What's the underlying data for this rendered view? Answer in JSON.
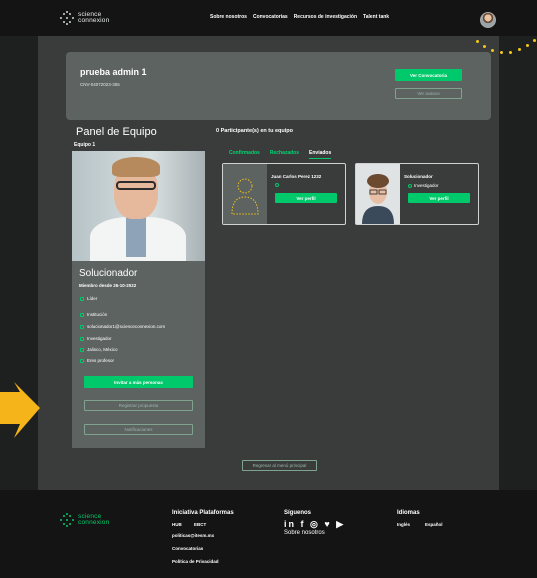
{
  "brand": {
    "line1": "science",
    "line2": "connexion"
  },
  "nav": [
    "Sobre nosotros",
    "Convocatorias",
    "Recursos de investigación",
    "Talent tank"
  ],
  "header": {
    "title": "prueba admin 1",
    "code": "CNV-04072023-355",
    "btn_primary": "Ver Convocatoria",
    "btn_secondary": "Ver avance"
  },
  "panel": {
    "title": "Panel de Equipo",
    "team": "Equipo 1"
  },
  "profile": {
    "role": "Solucionador",
    "since": "Miembro desde 26-10-2022",
    "lines": [
      "Líder",
      "Institución",
      "solucionador1@scienceconnexion.com",
      "Investigador",
      "Jalisco, México",
      "Eres profesor"
    ],
    "btn_invite": "Invitar a más personas",
    "btn_register": "Registrar propuesta",
    "btn_notifications": "Notificaciones"
  },
  "participants": {
    "title": "0 Participante(s) en tu equipo",
    "tabs": [
      "Confirmados",
      "Rechazados",
      "Enviados"
    ],
    "active_tab": "Enviados",
    "cards": [
      {
        "name": "Juan Carlos Perez 1232",
        "role": "",
        "button": "Ver perfil"
      },
      {
        "name": "Solucionador",
        "role": "Investigador",
        "button": "Ver perfil"
      }
    ]
  },
  "return_button": "Regresar al menú principal",
  "footer": {
    "col1": {
      "title": "Iniciativa Plataformas",
      "items": [
        "HUB",
        "EBCT",
        "politicas@itesm.mx",
        "Convocatorias",
        "Política de Privacidad"
      ]
    },
    "col2": {
      "title": "Síguenos",
      "social": "in f ◎ ♥ ▶",
      "link": "Sobre nosotros"
    },
    "col3": {
      "title": "Idiomas",
      "items": [
        "Inglés",
        "Español"
      ]
    }
  },
  "colors": {
    "accent": "#00c96b",
    "panel": "#5c6360",
    "bg": "#3a3c3b",
    "decor": "#f5c518"
  }
}
